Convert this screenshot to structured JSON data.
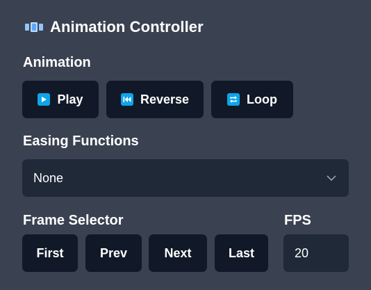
{
  "header": {
    "title": "Animation Controller",
    "icon": "film-strip-icon"
  },
  "animation": {
    "label": "Animation",
    "buttons": [
      {
        "label": "Play",
        "icon": "play-icon"
      },
      {
        "label": "Reverse",
        "icon": "rewind-icon"
      },
      {
        "label": "Loop",
        "icon": "repeat-icon"
      }
    ]
  },
  "easing": {
    "label": "Easing Functions",
    "selected": "None"
  },
  "frame_selector": {
    "label": "Frame Selector",
    "buttons": [
      "First",
      "Prev",
      "Next",
      "Last"
    ]
  },
  "fps": {
    "label": "FPS",
    "value": "20"
  },
  "colors": {
    "background": "#3a4150",
    "button": "#111827",
    "input": "#1f2937",
    "accent": "#0ea5e9"
  }
}
